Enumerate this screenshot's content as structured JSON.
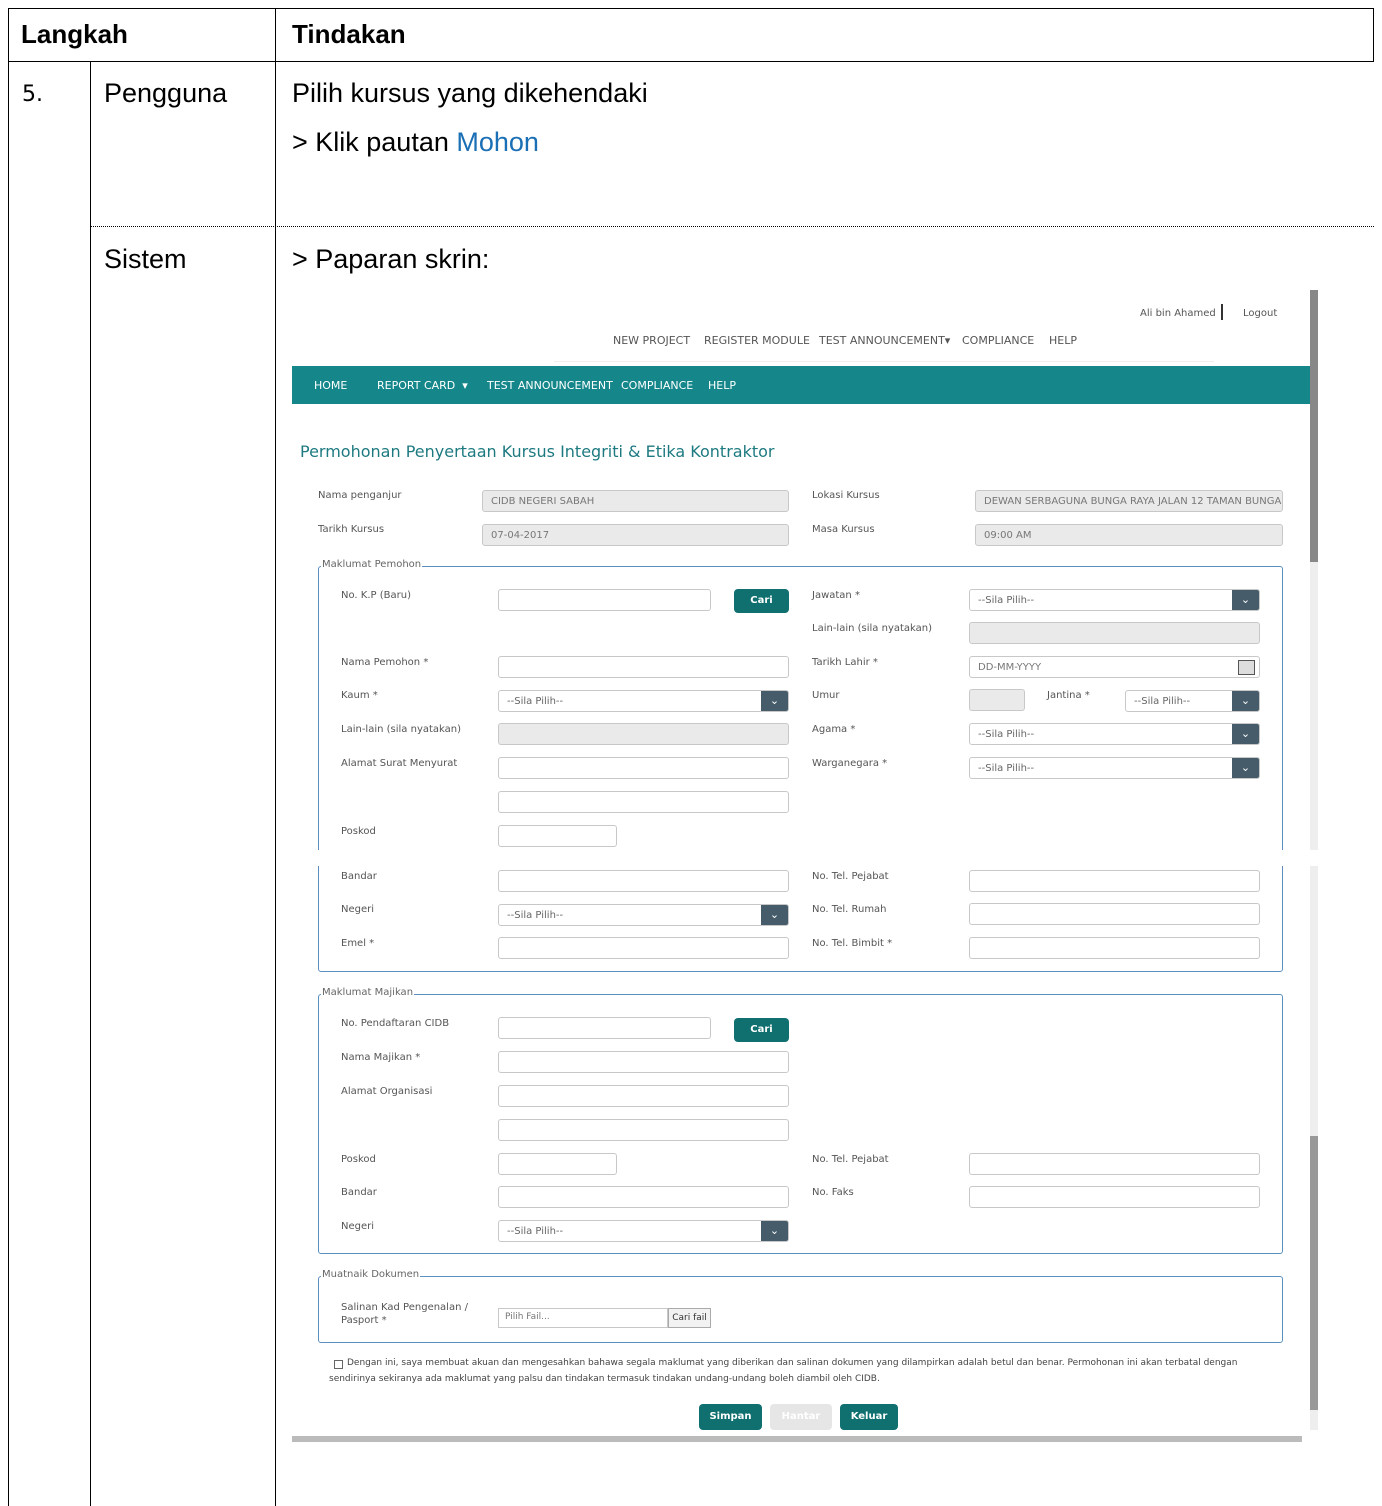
{
  "table": {
    "header_step": "Langkah",
    "header_action": "Tindakan",
    "step_number": "5.",
    "actor_user": "Pengguna",
    "actor_system": "Sistem",
    "user_action_line1": "Pilih kursus yang dikehendaki",
    "user_action_prefix": "> Klik pautan ",
    "user_action_link": "Mohon",
    "system_action": "> Paparan skrin:"
  },
  "screen": {
    "user_name": "Ali bin Ahamed",
    "logout": "Logout",
    "top_nav": [
      "NEW PROJECT",
      "REGISTER MODULE",
      "TEST ANNOUNCEMENT▾",
      "COMPLIANCE",
      "HELP"
    ],
    "main_nav": [
      "HOME",
      "REPORT CARD  ▾",
      "TEST ANNOUNCEMENT",
      "COMPLIANCE",
      "HELP"
    ],
    "page_title": "Permohonan Penyertaan Kursus Integriti & Etika Kontraktor",
    "course": {
      "organizer_label": "Nama penganjur",
      "organizer_value": "CIDB NEGERI SABAH",
      "location_label": "Lokasi Kursus",
      "location_value": "DEWAN SERBAGUNA BUNGA RAYA JALAN 12 TAMAN BUNGA",
      "date_label": "Tarikh Kursus",
      "date_value": "07-04-2017",
      "time_label": "Masa Kursus",
      "time_value": "09:00 AM"
    },
    "applicant": {
      "legend": "Maklumat Pemohon",
      "ic_label": "No. K.P (Baru)",
      "search_button": "Cari",
      "position_label": "Jawatan *",
      "others_label": "Lain-lain (sila nyatakan)",
      "name_label": "Nama Pemohon *",
      "dob_label": "Tarikh Lahir *",
      "dob_placeholder": "DD-MM-YYYY",
      "race_label": "Kaum *",
      "age_label": "Umur",
      "gender_label": "Jantina *",
      "others2_label": "Lain-lain (sila nyatakan)",
      "religion_label": "Agama *",
      "address_label": "Alamat Surat Menyurat",
      "nationality_label": "Warganegara *",
      "postcode_label": "Poskod",
      "city_label": "Bandar",
      "office_tel_label": "No. Tel. Pejabat",
      "state_label": "Negeri",
      "home_tel_label": "No. Tel. Rumah",
      "email_label": "Emel *",
      "mobile_label": "No. Tel. Bimbit *"
    },
    "employer": {
      "legend": "Maklumat Majikan",
      "cidb_label": "No. Pendaftaran CIDB",
      "search_button": "Cari",
      "name_label": "Nama Majikan *",
      "address_label": "Alamat Organisasi",
      "postcode_label": "Poskod",
      "office_tel_label": "No. Tel. Pejabat",
      "city_label": "Bandar",
      "fax_label": "No. Faks",
      "state_label": "Negeri"
    },
    "upload": {
      "legend": "Muatnaik Dokumen",
      "doc_label_1": "Salinan Kad Pengenalan /",
      "doc_label_2": "Pasport *",
      "file_placeholder": "Pilih Fail...",
      "browse_button": "Cari fail"
    },
    "select_placeholder": "--Sila Pilih--",
    "declaration_1": "Dengan ini, saya membuat akuan dan mengesahkan bahawa segala maklumat yang diberikan dan salinan dokumen yang dilampirkan adalah betul dan benar. Permohonan ini akan terbatal dengan",
    "declaration_2": "sendirinya sekiranya ada maklumat yang palsu dan tindakan termasuk tindakan undang-undang boleh diambil oleh CIDB.",
    "save_button": "Simpan",
    "submit_button": "Hantar",
    "exit_button": "Keluar"
  },
  "colors": {
    "teal_nav": "#15878a",
    "button": "#10706f",
    "link": "#1a6fb5",
    "title": "#1d7a80"
  }
}
